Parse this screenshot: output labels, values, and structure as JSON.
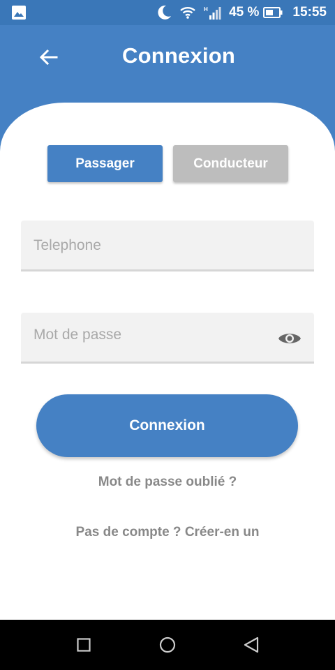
{
  "status_bar": {
    "battery": "45 %",
    "time": "15:55",
    "icons": [
      "image-notification-icon",
      "do-not-disturb-moon-icon",
      "wifi-icon",
      "cellular-signal-icon",
      "battery-icon"
    ]
  },
  "app_bar": {
    "title": "Connexion",
    "back_icon": "arrow-back-icon"
  },
  "roles": {
    "selected": "Passager",
    "items": [
      {
        "label": "Passager"
      },
      {
        "label": "Conducteur"
      }
    ]
  },
  "form": {
    "phone": {
      "placeholder": "Telephone",
      "value": ""
    },
    "password": {
      "placeholder": "Mot de passe",
      "value": "",
      "toggle_icon": "eye-icon"
    },
    "submit_label": "Connexion"
  },
  "links": {
    "forgot_password": "Mot de passe oublié ?",
    "create_account": "Pas de compte ? Créer-en un"
  },
  "nav_bar": {
    "icons": [
      "recents-square-icon",
      "home-circle-icon",
      "back-triangle-icon"
    ]
  },
  "colors": {
    "primary": "#4581c4",
    "status_bar": "#3a77b8",
    "inactive_role": "#bdbdbd",
    "field_background": "#f2f2f2",
    "link_text": "#888888"
  }
}
